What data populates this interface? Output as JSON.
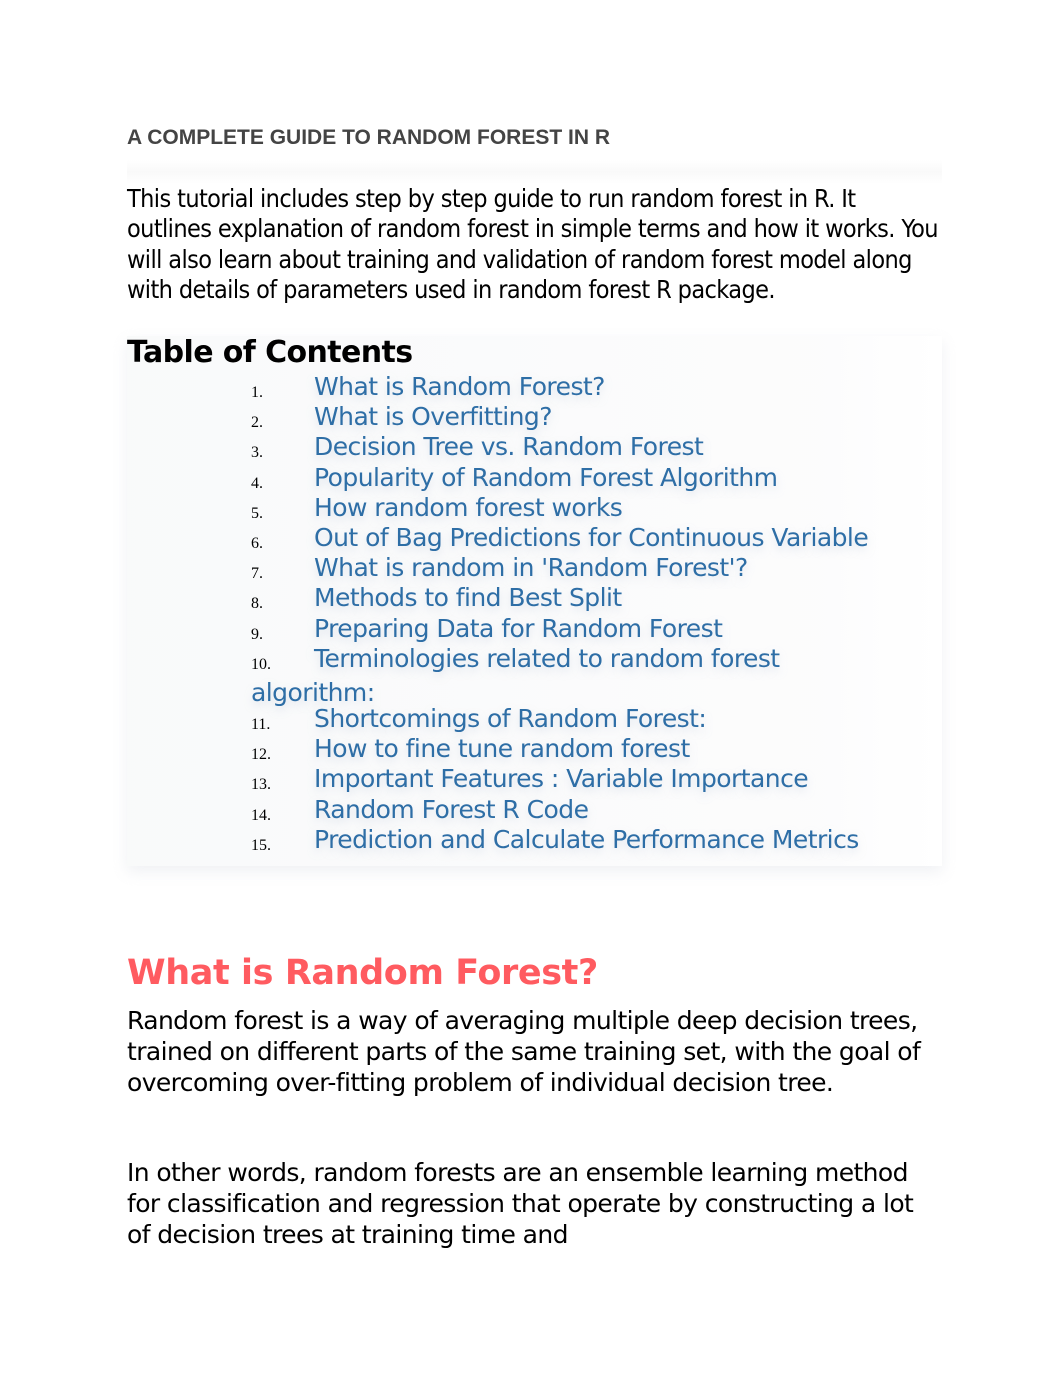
{
  "document": {
    "title": "A COMPLETE GUIDE TO RANDOM FOREST IN R",
    "intro": "This tutorial includes step by step guide to run random forest in R. It outlines explanation of random forest in simple terms and how it works. You will also learn about training and validation of random forest model along with details of parameters used in random forest R package.",
    "toc": {
      "heading": "Table of Contents",
      "link_color": "#2e6ea6",
      "items": [
        {
          "num": "1.",
          "label": "What is Random Forest?"
        },
        {
          "num": "2.",
          "label": "What is Overfitting?"
        },
        {
          "num": "3.",
          "label": "Decision Tree vs. Random Forest"
        },
        {
          "num": "4.",
          "label": "Popularity of Random Forest Algorithm"
        },
        {
          "num": "5.",
          "label": "How random forest works"
        },
        {
          "num": "6.",
          "label": "Out of Bag Predictions for Continuous Variable"
        },
        {
          "num": "7.",
          "label": "What is random in 'Random Forest'?"
        },
        {
          "num": "8.",
          "label": "Methods to find Best Split"
        },
        {
          "num": "9.",
          "label": "Preparing Data for Random Forest"
        },
        {
          "num": "10.",
          "label": "Terminologies related to random forest algorithm:"
        },
        {
          "num": "11.",
          "label": "Shortcomings of Random Forest:"
        },
        {
          "num": "12.",
          "label": "How to fine tune random forest"
        },
        {
          "num": "13.",
          "label": "Important Features : Variable Importance"
        },
        {
          "num": "14.",
          "label": "Random Forest R Code"
        },
        {
          "num": "15.",
          "label": "Prediction and Calculate Performance Metrics"
        }
      ]
    },
    "section": {
      "heading": "What is Random Forest?",
      "heading_color": "#ff5b60",
      "paragraphs": [
        "Random forest is a way of averaging multiple deep decision trees, trained on different parts of the same training set, with the goal of overcoming over-fitting problem of individual decision tree.",
        "In other words, random forests are an ensemble learning method for classification and regression that operate by constructing a lot of decision trees at training time and"
      ]
    }
  }
}
